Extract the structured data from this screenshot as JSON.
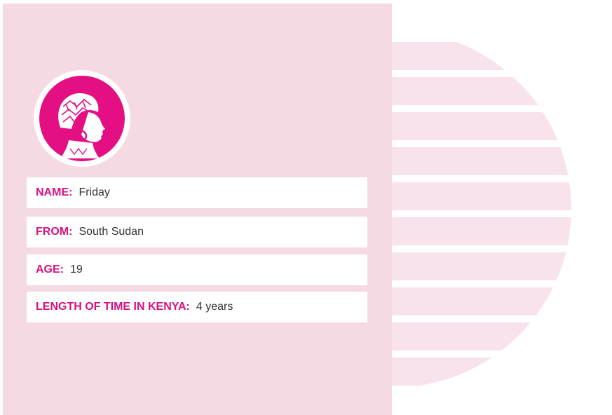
{
  "profile": {
    "avatar_icon": "woman-profile-headwrap-icon",
    "fields": [
      {
        "label": "NAME:",
        "value": "Friday"
      },
      {
        "label": "FROM:",
        "value": "South Sudan"
      },
      {
        "label": "AGE:",
        "value": "19"
      },
      {
        "label": "LENGTH OF TIME IN KENYA:",
        "value": "4 years"
      }
    ]
  },
  "colors": {
    "accent": "#e30f83",
    "panel": "#f5d9e3",
    "stripe": "#f8e3ec"
  }
}
